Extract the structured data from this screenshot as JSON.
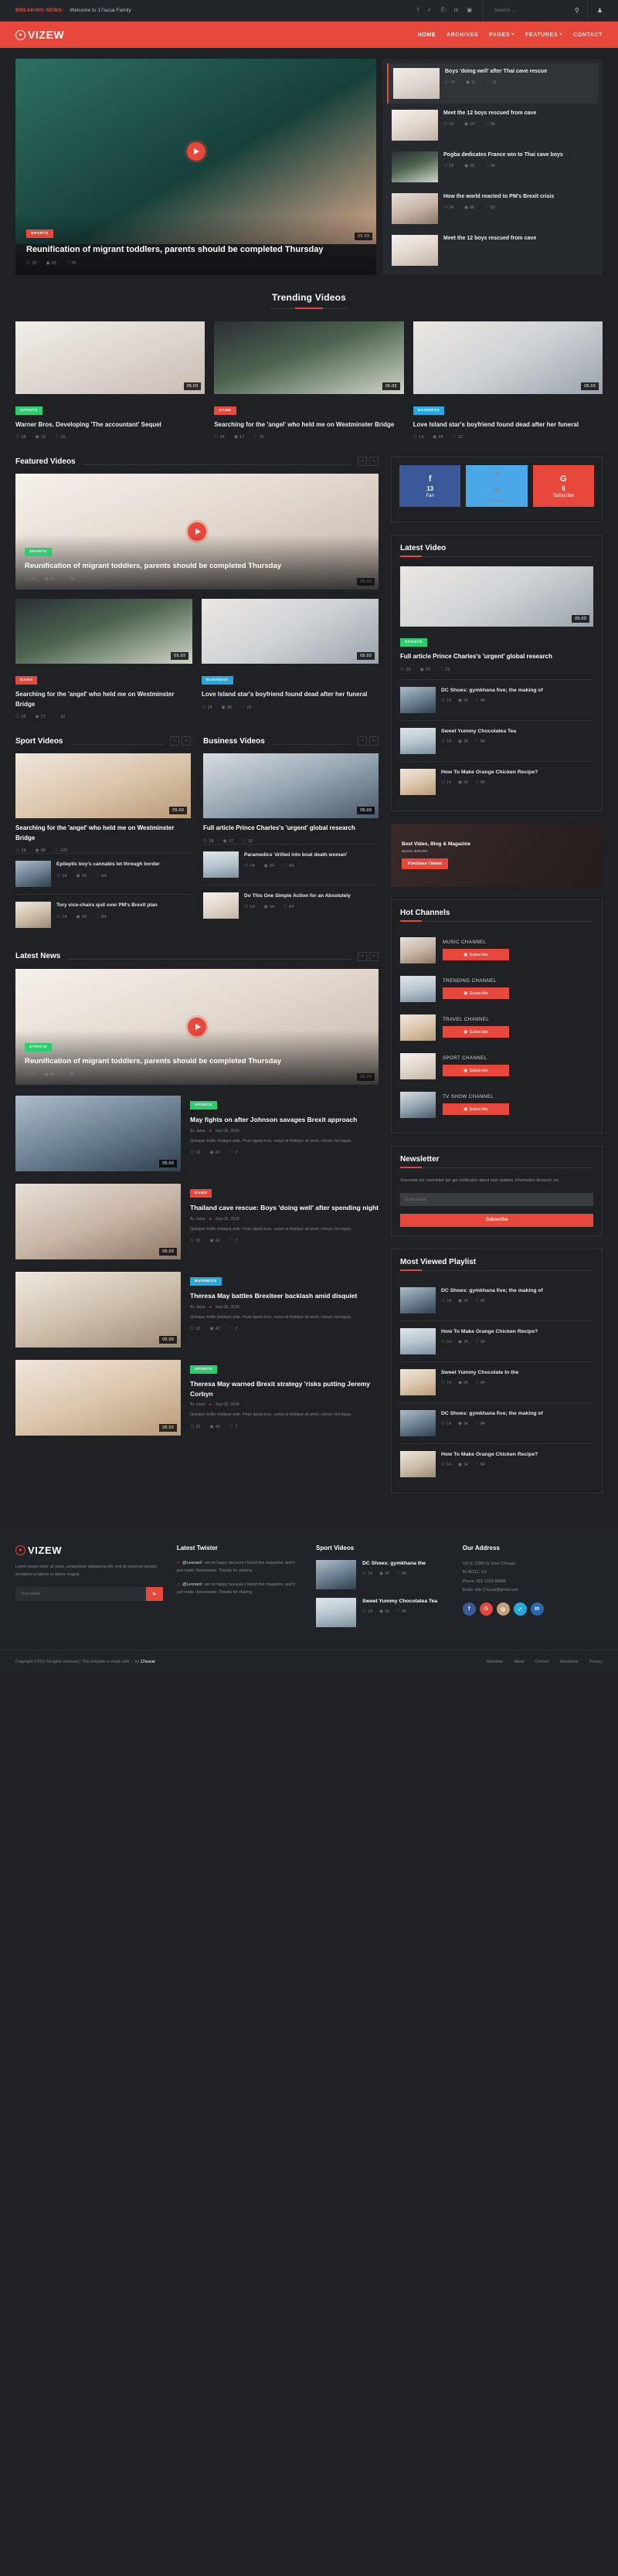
{
  "topbar": {
    "breaking_label": "BREAKING NEWS:",
    "breaking_text": "Welcome to 17sucai Family",
    "socials": [
      "f",
      "✓",
      "Ⓕ",
      "in",
      "▣"
    ],
    "search_placeholder": "Search ...",
    "search_value": "",
    "search_icon": "⚲",
    "user_icon": "♟"
  },
  "header": {
    "logo": "VIZEW",
    "nav": [
      {
        "label": "HOME",
        "caret": false,
        "active": true
      },
      {
        "label": "ARCHIVES",
        "caret": false,
        "active": false
      },
      {
        "label": "PAGES",
        "caret": true,
        "active": false
      },
      {
        "label": "FEATURES",
        "caret": true,
        "active": false
      },
      {
        "label": "CONTACT",
        "caret": false,
        "active": false
      }
    ]
  },
  "hero": {
    "main": {
      "category": "SPORTS",
      "title": "Reunification of migrant toddlers, parents should be completed Thursday",
      "comments": "25",
      "views": "25",
      "likes": "25",
      "duration": "05.03"
    },
    "list": [
      {
        "title": "Boys 'doing well' after Thai cave rescue",
        "comments": "25",
        "views": "11",
        "likes": "19"
      },
      {
        "title": "Meet the 12 boys rescued from cave",
        "comments": "14",
        "views": "34",
        "likes": "84"
      },
      {
        "title": "Pogba dedicates France win to Thai cave boys",
        "comments": "14",
        "views": "34",
        "likes": "84"
      },
      {
        "title": "How the world reacted to PM's Brexit crisis",
        "comments": "24",
        "views": "98",
        "likes": "63"
      },
      {
        "title": "Meet the 12 boys rescued from cave",
        "comments": "14",
        "views": "34",
        "likes": "84"
      }
    ]
  },
  "trending": {
    "title": "Trending Videos",
    "items": [
      {
        "category": "SPORTS",
        "cat_class": "sports",
        "title": "Warner Bros. Developing 'The accountant' Sequel",
        "duration": "05.03",
        "comments": "28",
        "views": "19",
        "likes": "15"
      },
      {
        "category": "GAME",
        "cat_class": "game",
        "title": "Searching for the 'angel' who held me on Westminster Bridge",
        "duration": "05.03",
        "comments": "24",
        "views": "17",
        "likes": "32"
      },
      {
        "category": "BUSINESS",
        "cat_class": "business",
        "title": "Love Island star's boyfriend found dead after her funeral",
        "duration": "05.03",
        "comments": "14",
        "views": "98",
        "likes": "22"
      }
    ]
  },
  "featured": {
    "title": "Featured Videos",
    "big": {
      "category": "SPORTS",
      "cat_class": "sports",
      "title": "Reunification of migrant toddlers, parents should be completed Thursday",
      "duration": "05.03",
      "comments": "25",
      "views": "45",
      "likes": "25"
    },
    "small": [
      {
        "category": "GAME",
        "cat_class": "game",
        "title": "Searching for the 'angel' who held me on Westminster Bridge",
        "duration": "05.03",
        "comments": "28",
        "views": "17",
        "likes": "32"
      },
      {
        "category": "BUSINESS",
        "cat_class": "business",
        "title": "Love Island star's boyfriend found dead after her funeral",
        "duration": "05.03",
        "comments": "14",
        "views": "98",
        "likes": "22"
      }
    ]
  },
  "social_counters": [
    {
      "glyph": "f",
      "count": "13",
      "label": "Fan",
      "cls": "fb",
      "name": "facebook"
    },
    {
      "glyph": "✓",
      "count": "14",
      "label": "Followers",
      "cls": "tw",
      "name": "twitter"
    },
    {
      "glyph": "G",
      "count": "9",
      "label": "Subscribe",
      "cls": "gp",
      "name": "google-plus"
    }
  ],
  "latest_video": {
    "title": "Latest Video",
    "main": {
      "category": "SPORTS",
      "cat_class": "sports",
      "title": "Full article Prince Charles's 'urgent' global research",
      "duration": "05.03",
      "comments": "19",
      "views": "29",
      "likes": "23"
    },
    "items": [
      {
        "title": "DC Shoes: gymkhana five; the making of",
        "comments": "14",
        "views": "34",
        "likes": "84"
      },
      {
        "title": "Sweet Yummy Chocolatea Tea",
        "comments": "14",
        "views": "34",
        "likes": "84"
      },
      {
        "title": "How To Make Orange Chicken Recipe?",
        "comments": "14",
        "views": "34",
        "likes": "84"
      }
    ]
  },
  "ad": {
    "title": "Best Video, Blog & Magazine",
    "subtitle": "Banner 300x250",
    "button": "Purchase Theme"
  },
  "sport_videos": {
    "title": "Sport Videos",
    "big": {
      "category": "SPORTS",
      "cat_class": "sports",
      "title": "Searching for the 'angel' who held me on Westminster Bridge",
      "duration": "05.03",
      "comments": "18",
      "views": "98",
      "likes": "122"
    },
    "items": [
      {
        "title": "Epileptic boy's cannabis let through border",
        "comments": "14",
        "views": "34",
        "likes": "84"
      },
      {
        "title": "Tory vice-chairs quit over PM's Brexit plan",
        "comments": "14",
        "views": "34",
        "likes": "84"
      }
    ]
  },
  "business_videos": {
    "title": "Business Videos",
    "big": {
      "category": "BUSINESS",
      "cat_class": "business",
      "title": "Full article Prince Charles's 'urgent' global research",
      "duration": "05.03",
      "comments": "28",
      "views": "17",
      "likes": "32"
    },
    "items": [
      {
        "title": "Paramedics 'drilled into boat death woman'",
        "comments": "14",
        "views": "34",
        "likes": "84"
      },
      {
        "title": "Do This One Simple Action for an Absolutely",
        "comments": "14",
        "views": "34",
        "likes": "84"
      }
    ]
  },
  "hot_channels": {
    "title": "Hot Channels",
    "subscribe_label": "Subscribe",
    "items": [
      {
        "name": "MUSIC CHANNEL"
      },
      {
        "name": "TRENDING CHANNEL"
      },
      {
        "name": "TRAVEL CHANNEL"
      },
      {
        "name": "SPORT CHANNEL"
      },
      {
        "name": "TV SHOW CHANNEL"
      }
    ]
  },
  "newsletter": {
    "title": "Newsletter",
    "description": "Subscribe our newsletter gor get notification about new updates, information discount, etc.",
    "placeholder": "Enter email",
    "button": "Subscribe"
  },
  "latest_news": {
    "title": "Latest News",
    "hero": {
      "category": "SPORTS",
      "cat_class": "sports",
      "title": "Reunification of migrant toddlers, parents should be completed Thursday",
      "duration": "05.03",
      "comments": "25",
      "views": "45",
      "likes": "25"
    },
    "items": [
      {
        "category": "SPORTS",
        "cat_class": "sports",
        "title": "May fights on after Johnson savages Brexit approach",
        "author": "By Jaise",
        "date": "Sep 08, 2018",
        "excerpt": "Quisque mollis tristique ante. Proin ligula eros, varius id tristique sit amet, rutrum non ligula.",
        "duration": "05.03",
        "comments": "32",
        "views": "42",
        "likes": "7"
      },
      {
        "category": "GAME",
        "cat_class": "game",
        "title": "Thailand cave rescue: Boys 'doing well' after spending night",
        "author": "By Jaise",
        "date": "Sep 08, 2018",
        "excerpt": "Quisque mollis tristique ante. Proin ligula eros, varius id tristique sit amet, rutrum non ligula.",
        "duration": "05.03",
        "comments": "32",
        "views": "42",
        "likes": "7"
      },
      {
        "category": "BUSINESS",
        "cat_class": "business",
        "title": "Theresa May battles Brexiteer backlash amid disquiet",
        "author": "By Jaise",
        "date": "Sep 08, 2018",
        "excerpt": "Quisque mollis tristique ante. Proin ligula eros, varius id tristique sit amet, rutrum non ligula.",
        "duration": "05.03",
        "comments": "32",
        "views": "42",
        "likes": "7"
      },
      {
        "category": "SPORTS",
        "cat_class": "sports",
        "title": "Theresa May warned Brexit strategy 'risks putting Jeremy Corbyn",
        "author": "By Jaise",
        "date": "Sep 08, 2018",
        "excerpt": "Quisque mollis tristique ante. Proin ligula eros, varius id tristique sit amet, rutrum non ligula.",
        "duration": "05.03",
        "comments": "32",
        "views": "42",
        "likes": "7"
      }
    ]
  },
  "most_viewed": {
    "title": "Most Viewed Playlist",
    "items": [
      {
        "title": "DC Shoes: gymkhana five; the making of",
        "comments": "14",
        "views": "34",
        "likes": "84"
      },
      {
        "title": "How To Make Orange Chicken Recipe?",
        "comments": "14",
        "views": "34",
        "likes": "84"
      },
      {
        "title": "Sweet Yummy Chocolate In the",
        "comments": "14",
        "views": "34",
        "likes": "84"
      },
      {
        "title": "DC Shoes: gymkhana five; the making of",
        "comments": "14",
        "views": "34",
        "likes": "84"
      },
      {
        "title": "How To Make Orange Chicken Recipe?",
        "comments": "14",
        "views": "34",
        "likes": "84"
      }
    ]
  },
  "footer": {
    "logo": "VIZEW",
    "description": "Lorem ipsum dolor sit amet, consectetur adipisicing elit, sed do eiusmod tempor incididunt ut labore et dolore magna",
    "email_placeholder": "Your email",
    "send_icon": "➤",
    "twitter": {
      "title": "Latest Twister",
      "items": [
        {
          "handle": "@Leonard",
          "text": "I am so happy because I found this magazine, and it just made Vizeweasier. Thanks for sharing"
        },
        {
          "handle": "@Leonard",
          "text": "I am so happy because I found this magazine, and it just made Vizeweasier. Thanks for sharing"
        }
      ]
    },
    "sport_videos": {
      "title": "Sport Videos",
      "items": [
        {
          "title": "DC Shoes: gymkhana the",
          "comments": "14",
          "views": "34",
          "likes": "84"
        },
        {
          "title": "Sweet Yummy Chocolatea Tea",
          "comments": "14",
          "views": "34",
          "likes": "84"
        }
      ]
    },
    "address": {
      "title": "Our Address",
      "line1": "101 E 129th St, East Chicago,",
      "line2": "IN 46312, US",
      "phone": "Phone: 001-1234-88888",
      "email": "Email: info.17sucai@gmail.com",
      "socials": [
        {
          "glyph": "f",
          "cls": "f",
          "name": "facebook"
        },
        {
          "glyph": "G",
          "cls": "g",
          "name": "google-plus"
        },
        {
          "glyph": "◎",
          "cls": "i",
          "name": "instagram"
        },
        {
          "glyph": "✓",
          "cls": "t",
          "name": "twitter"
        },
        {
          "glyph": "in",
          "cls": "l",
          "name": "linkedin"
        }
      ]
    },
    "bottom": {
      "copyright_pre": "Copyright ©2022 All rights reserved | This template is made with ",
      "heart": "♡",
      "copyright_mid": " by ",
      "brand": "17sucai",
      "links": [
        "Advertise",
        "About",
        "Contact",
        "Disclaimer",
        "Privacy"
      ]
    }
  },
  "icons": {
    "comment": "⚇",
    "eye": "◉",
    "like": "♡",
    "prev": "‹",
    "next": "›",
    "play_circle": "◉"
  }
}
